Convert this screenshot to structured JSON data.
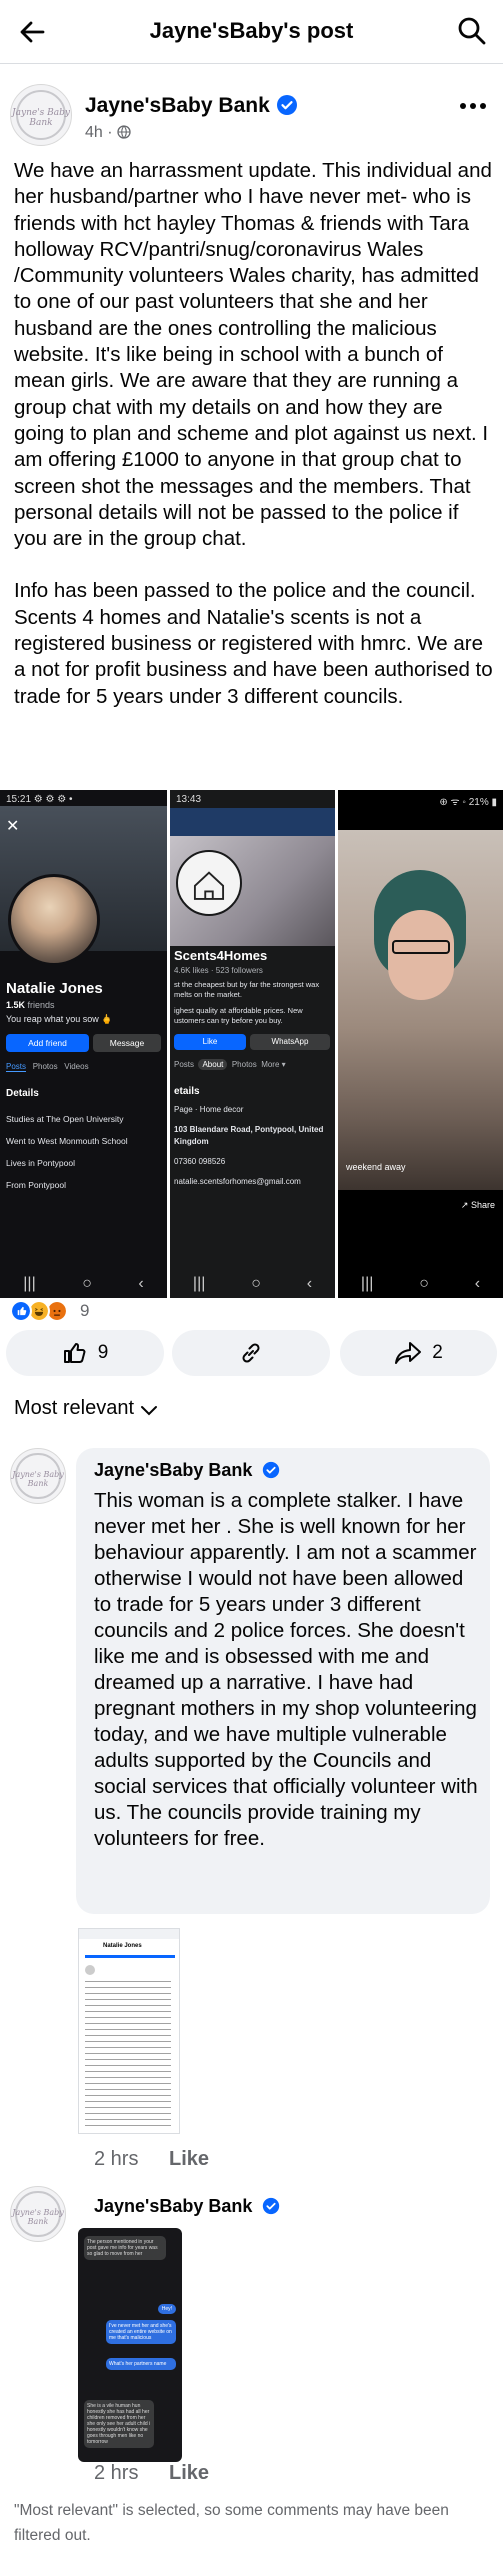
{
  "header": {
    "title": "Jayne'sBaby's post"
  },
  "post": {
    "author": "Jayne'sBaby Bank",
    "avatar_text": "Jayne's Baby Bank",
    "time": "4h",
    "privacy_separator": "·",
    "paragraphs": [
      "We have an harrassment update. This individual and her husband/partner who I have never met- who is friends with hct hayley Thomas & friends with Tara holloway RCV/pantri/snug/coronavirus Wales /Community volunteers Wales charity, has admitted to one of our past volunteers that she and her husband are the ones controlling the malicious website. It's like being in school with a bunch of mean girls. We are aware that they are running a group chat with my details on and how they are going to plan and scheme and plot against us next. I am offering £1000 to anyone in that group chat to screen shot the messages and the members. That personal details will not be passed to the police if you are in the group chat.",
      "Info has been passed to the police and the council. Scents 4 homes and Natalie's scents is not a registered business or registered with hmrc. We are a not for profit business and have been authorised to trade for 5 years under 3 different councils."
    ]
  },
  "screenshots": {
    "s1": {
      "status": "15:21 ⚙ ⚙ ⚙ •",
      "name": "Natalie Jones",
      "friends_count": "1.5K",
      "friends_label": "friends",
      "tagline": "You reap what you sow 🖕",
      "add_friend": "Add friend",
      "message": "Message",
      "tabs": [
        "Posts",
        "Photos",
        "Videos"
      ],
      "details_heading": "Details",
      "details": [
        "Studies at The Open University",
        "Went to West Monmouth School",
        "Lives in Pontypool",
        "From Pontypool"
      ],
      "nav": [
        "|||",
        "○",
        "‹"
      ]
    },
    "s2": {
      "status": "13:43",
      "name": "Scents4Homes",
      "likes": "4.6K likes",
      "followers": "523 followers",
      "bio1": "st the cheapest but by far the strongest wax melts on the market.",
      "bio2": "ighest quality at affordable prices. New ustomers can try before you buy.",
      "like": "Like",
      "whatsapp": "WhatsApp",
      "tabs": [
        "Posts",
        "About",
        "Photos",
        "More ▾"
      ],
      "details_heading": "etails",
      "details": [
        "Page · Home decor",
        "103 Blaendare Road, Pontypool, United Kingdom",
        "07360 098526",
        "natalie.scentsforhomes@gmail.com"
      ],
      "nav": [
        "|||",
        "○",
        "‹"
      ]
    },
    "s3": {
      "status": "⊕ ᯤ ◦ 21% ▮",
      "caption": "weekend away",
      "share": "Share",
      "nav": [
        "|||",
        "○",
        "‹"
      ]
    }
  },
  "reactions": {
    "count": "9"
  },
  "actions": {
    "like_count": "9",
    "share_count": "2"
  },
  "comments_sort": {
    "label": "Most relevant"
  },
  "comments": [
    {
      "author": "Jayne'sBaby Bank",
      "text": "This woman is a complete stalker. I have never met her . She is well known for her behaviour apparently. I am not a scammer otherwise I would not have been allowed to trade for 5 years under 3 different councils and 2 police forces. She doesn't like me and  is obsessed with me and dreamed up a narrative. I have had pregnant mothers in my shop volunteering today, and we have multiple vulnerable adults supported by the Councils and social services that officially volunteer with us.  The councils provide  training my volunteers for free.",
      "time": "2 hrs",
      "like": "Like",
      "attachment_author": "Natalie Jones"
    },
    {
      "author": "Jayne'sBaby Bank",
      "time": "2 hrs",
      "like": "Like",
      "chat": {
        "incoming": "The person mentioned in your post gave me info for years was so glad to move from her",
        "outgoing1": "Hey!",
        "outgoing2": "I've never met her and she's created an entire website on me that's malicious",
        "outgoing3": "What's her partners name",
        "incoming2": "She is a vile human hun honestly she has had all her children removed from her she only see her adult child i honestly wouldn't know she goes through men like no tomorrow"
      }
    }
  ],
  "footer": {
    "note": "\"Most relevant\" is selected, so some comments may have been filtered out."
  },
  "colors": {
    "link_blue": "#0866ff",
    "muted": "#65676b",
    "bubble": "#f0f2f5"
  }
}
